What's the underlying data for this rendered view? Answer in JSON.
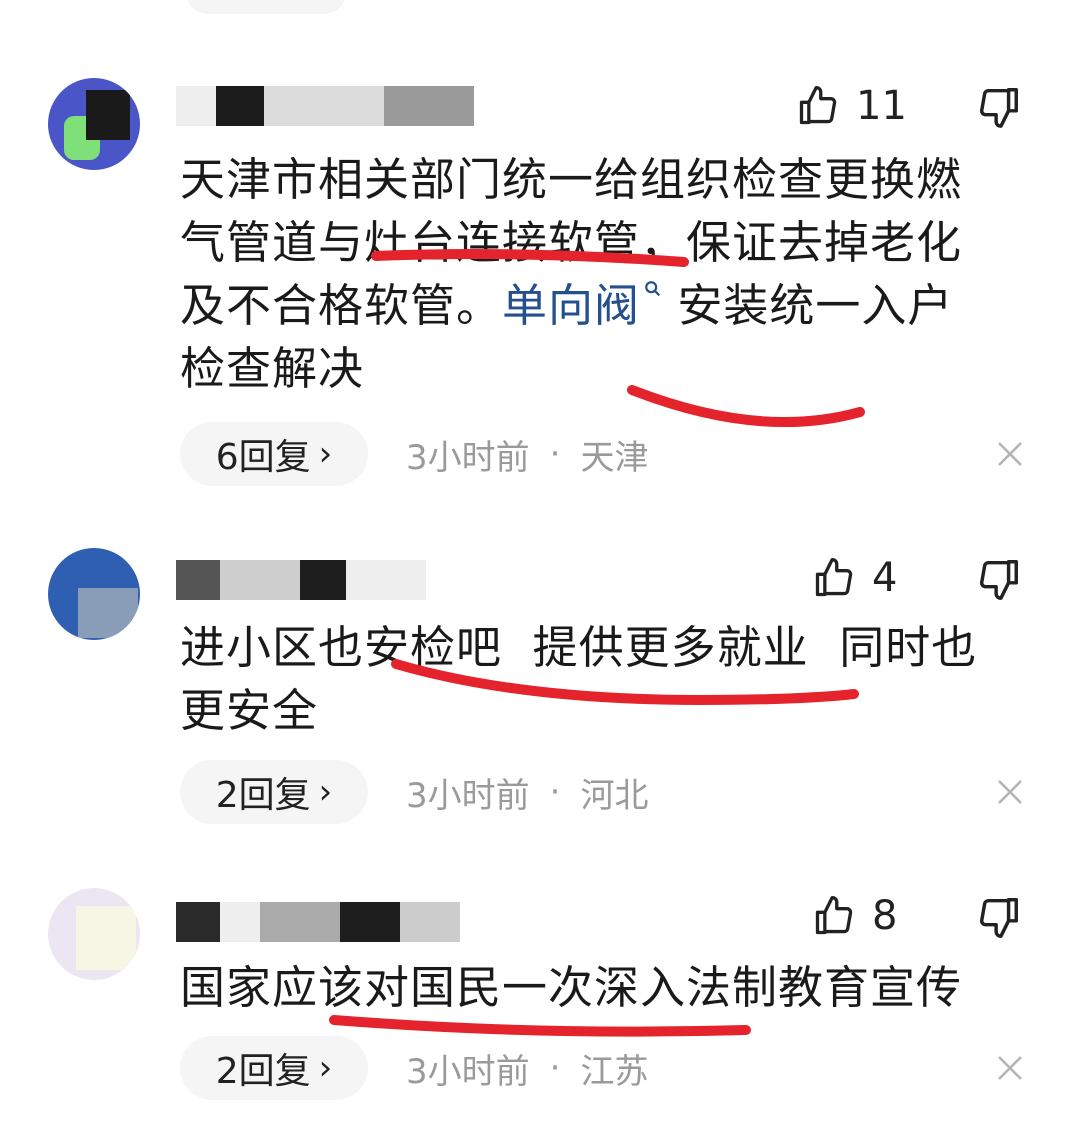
{
  "comments": [
    {
      "text": [
        "天津市相关部门统一给组织检查更换燃",
        "气管道与灶台连接软管，保证去掉老化",
        "及不合格软管。",
        "单向阀",
        "安装统一入户",
        "检查解决"
      ],
      "likes": "11",
      "replies": "6回复",
      "time": "3小时前",
      "location": "天津"
    },
    {
      "text": [
        "进小区也安检吧  提供更多就业  同时也",
        "更安全"
      ],
      "likes": "4",
      "replies": "2回复",
      "time": "3小时前",
      "location": "河北"
    },
    {
      "text": [
        "国家应该对国民一次深入法制教育宣传"
      ],
      "likes": "8",
      "replies": "2回复",
      "time": "3小时前",
      "location": "江苏"
    }
  ],
  "meta": {
    "separator": "·",
    "chevron": "›"
  },
  "colors": {
    "link": "#24508d",
    "underline": "#e5232c",
    "muted": "#9a9a9a",
    "pill": "#f5f5f5"
  },
  "icons": [
    "thumbs-up-icon",
    "thumbs-down-icon",
    "close-icon",
    "search-icon",
    "chevron-right-icon"
  ]
}
